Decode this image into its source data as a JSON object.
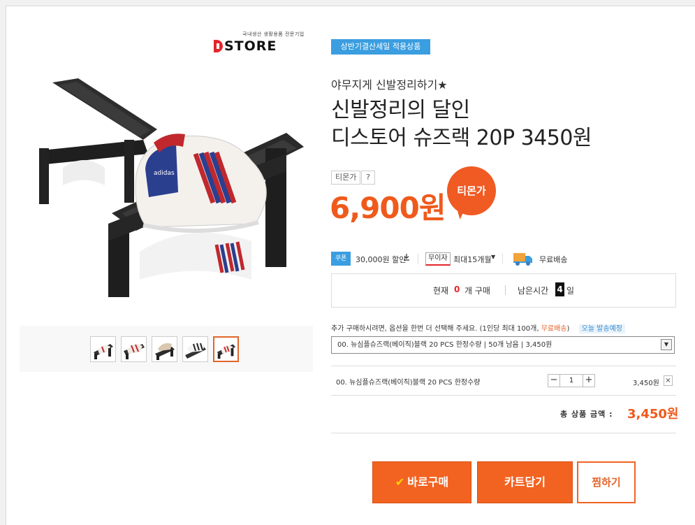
{
  "brand": {
    "tagline": "국내생산 생활용품 전문기업",
    "logo_text": "STORE"
  },
  "thumbnails": [
    {
      "name": "thumb-1"
    },
    {
      "name": "thumb-2"
    },
    {
      "name": "thumb-3"
    },
    {
      "name": "thumb-4"
    },
    {
      "name": "thumb-5",
      "selected": true
    }
  ],
  "product": {
    "event_badge": "상반기결산세일 적용상품",
    "subtitle": "야무지게 신발정리하기★",
    "title_line1": "신발정리의 달인",
    "title_line2": "디스토어 슈즈랙 20P 3450원",
    "price_tag": "티몬가",
    "help": "?",
    "price": "6,900원",
    "price_bubble": "티몬가"
  },
  "benefits": {
    "coupon_badge": "쿠폰",
    "coupon_text": "30,000원 할인",
    "installment_badge": "무이자",
    "installment_text": "최대15개월",
    "delivery_text": "무료배송"
  },
  "status": {
    "current_label": "현재",
    "current_count": "0",
    "current_unit": "개 구매",
    "remaining_label": "남은시간",
    "remaining_days": "4",
    "remaining_unit": "일"
  },
  "options": {
    "notice_prefix": "추가 구매하시려면, 옵션을 한번 더 선택해 주세요. (1인당 최대 100개,",
    "notice_free": "무료배송",
    "notice_suffix": ")",
    "notice_today": "오늘 발송예정",
    "selected_option": "00. 뉴심플슈즈랙(베이직)블랙 20 PCS 한정수량 | 50개 남음 | 3,450원"
  },
  "selected_item": {
    "name": "00. 뉴심플슈즈랙(베이직)블랙 20 PCS 한정수량",
    "minus": "−",
    "quantity": "1",
    "plus": "+",
    "price": "3,450원",
    "remove": "×"
  },
  "total": {
    "label": "총 상품 금액 :",
    "value": "3,450원"
  },
  "buttons": {
    "buy": "바로구매",
    "cart": "카트담기",
    "wish": "찜하기"
  }
}
